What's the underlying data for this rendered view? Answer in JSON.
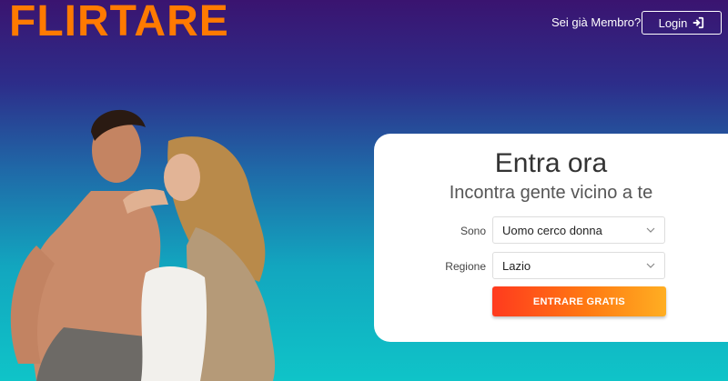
{
  "header": {
    "logo": "FLIRTARE",
    "member_text": "Sei già Membro?",
    "login_label": "Login",
    "login_icon": "sign-in-icon"
  },
  "card": {
    "title": "Entra ora",
    "subtitle": "Incontra gente vicino a te",
    "fields": [
      {
        "label": "Sono",
        "value": "Uomo cerco donna"
      },
      {
        "label": "Regione",
        "value": "Lazio"
      }
    ],
    "cta_label": "ENTRARE GRATIS"
  },
  "colors": {
    "logo": "#ff7a00",
    "bg_top": "#3a1470",
    "bg_bottom": "#0fc4c8",
    "cta_start": "#ff3a1e",
    "cta_end": "#ffae22"
  }
}
